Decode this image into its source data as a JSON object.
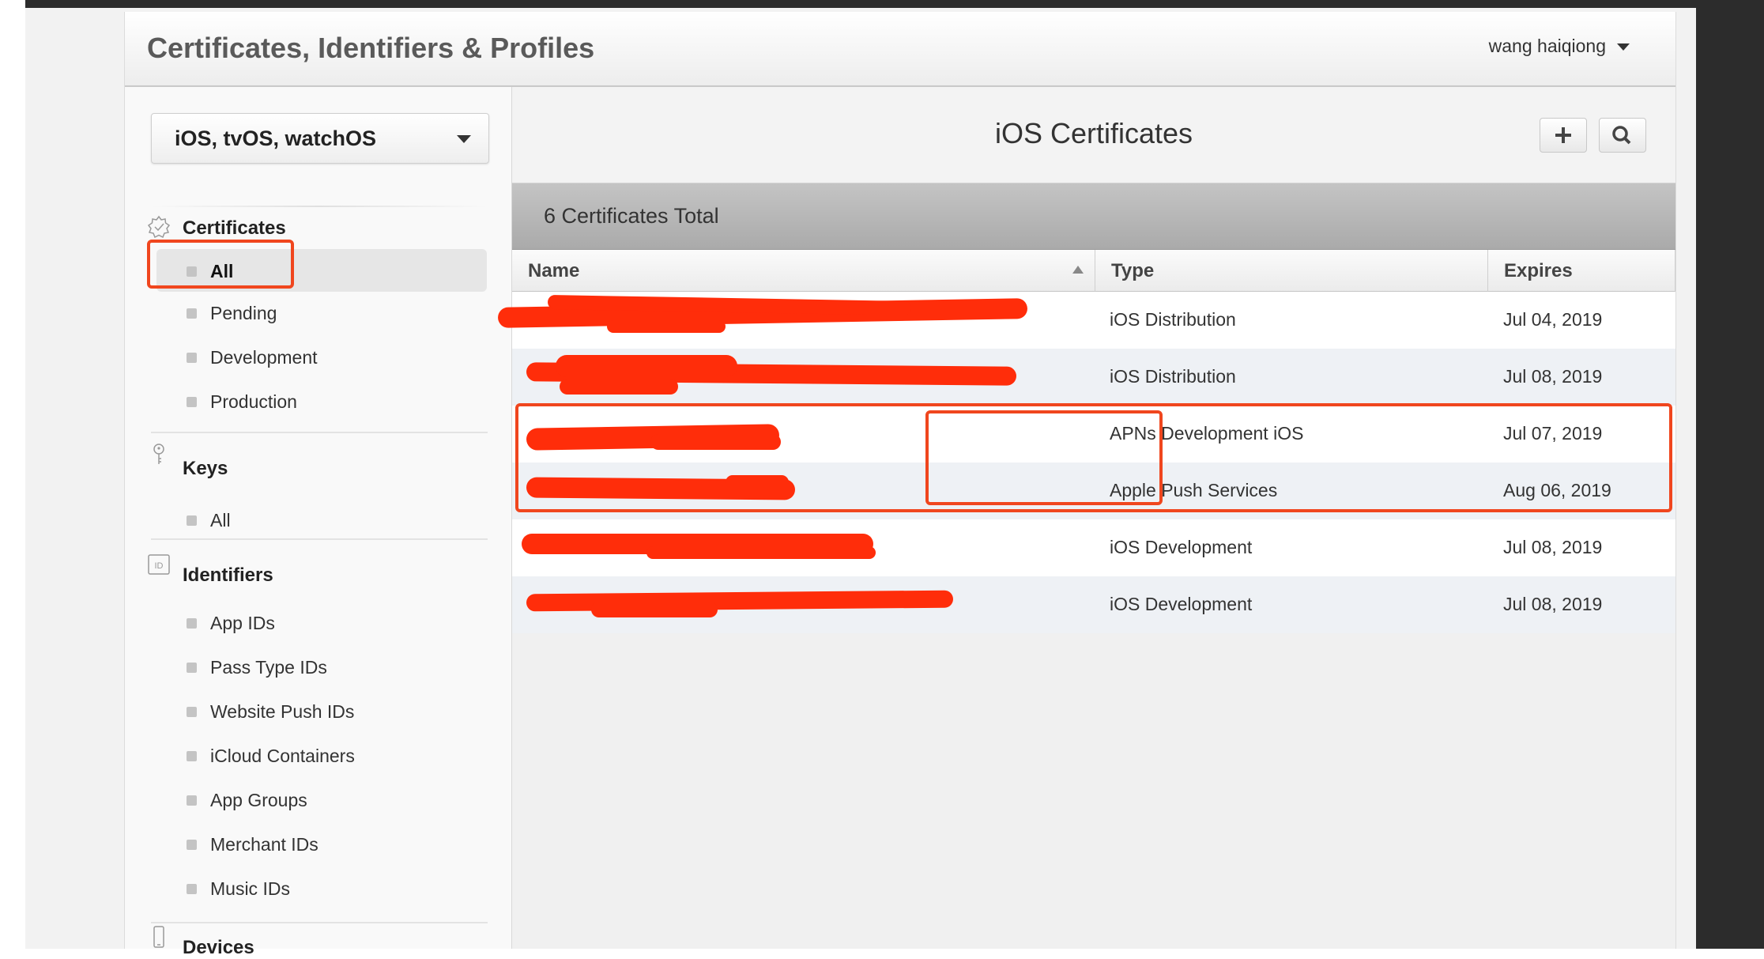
{
  "app": {
    "title": "Certificates, Identifiers & Profiles",
    "user": "wang haiqiong"
  },
  "sidebar": {
    "platform": "iOS, tvOS, watchOS",
    "sections": {
      "certificates": {
        "title": "Certificates",
        "items": [
          "All",
          "Pending",
          "Development",
          "Production"
        ],
        "active": "All"
      },
      "keys": {
        "title": "Keys",
        "items": [
          "All"
        ]
      },
      "identifiers": {
        "title": "Identifiers",
        "items": [
          "App IDs",
          "Pass Type IDs",
          "Website Push IDs",
          "iCloud Containers",
          "App Groups",
          "Merchant IDs",
          "Music IDs"
        ]
      },
      "devices": {
        "title": "Devices"
      }
    }
  },
  "main": {
    "title": "iOS Certificates",
    "total": "6 Certificates Total",
    "columns": {
      "name": "Name",
      "type": "Type",
      "expires": "Expires"
    },
    "rows": [
      {
        "type": "iOS Distribution",
        "expires": "Jul 04, 2019"
      },
      {
        "type": "iOS Distribution",
        "expires": "Jul 08, 2019"
      },
      {
        "type": "APNs Development iOS",
        "expires": "Jul 07, 2019"
      },
      {
        "type": "Apple Push Services",
        "expires": "Aug 06, 2019"
      },
      {
        "type": "iOS Development",
        "expires": "Jul 08, 2019"
      },
      {
        "type": "iOS Development",
        "expires": "Jul 08, 2019"
      }
    ]
  },
  "icons": {
    "user_menu": "chevron-down-icon",
    "platform_select": "chevron-down-icon",
    "add": "plus-icon",
    "search": "search-icon",
    "certificates": "certificate-badge-icon",
    "keys": "key-icon",
    "identifiers": "id-icon",
    "devices": "phone-icon"
  },
  "colors": {
    "annotation": "#f0461e",
    "redaction": "#ff2d0a"
  }
}
